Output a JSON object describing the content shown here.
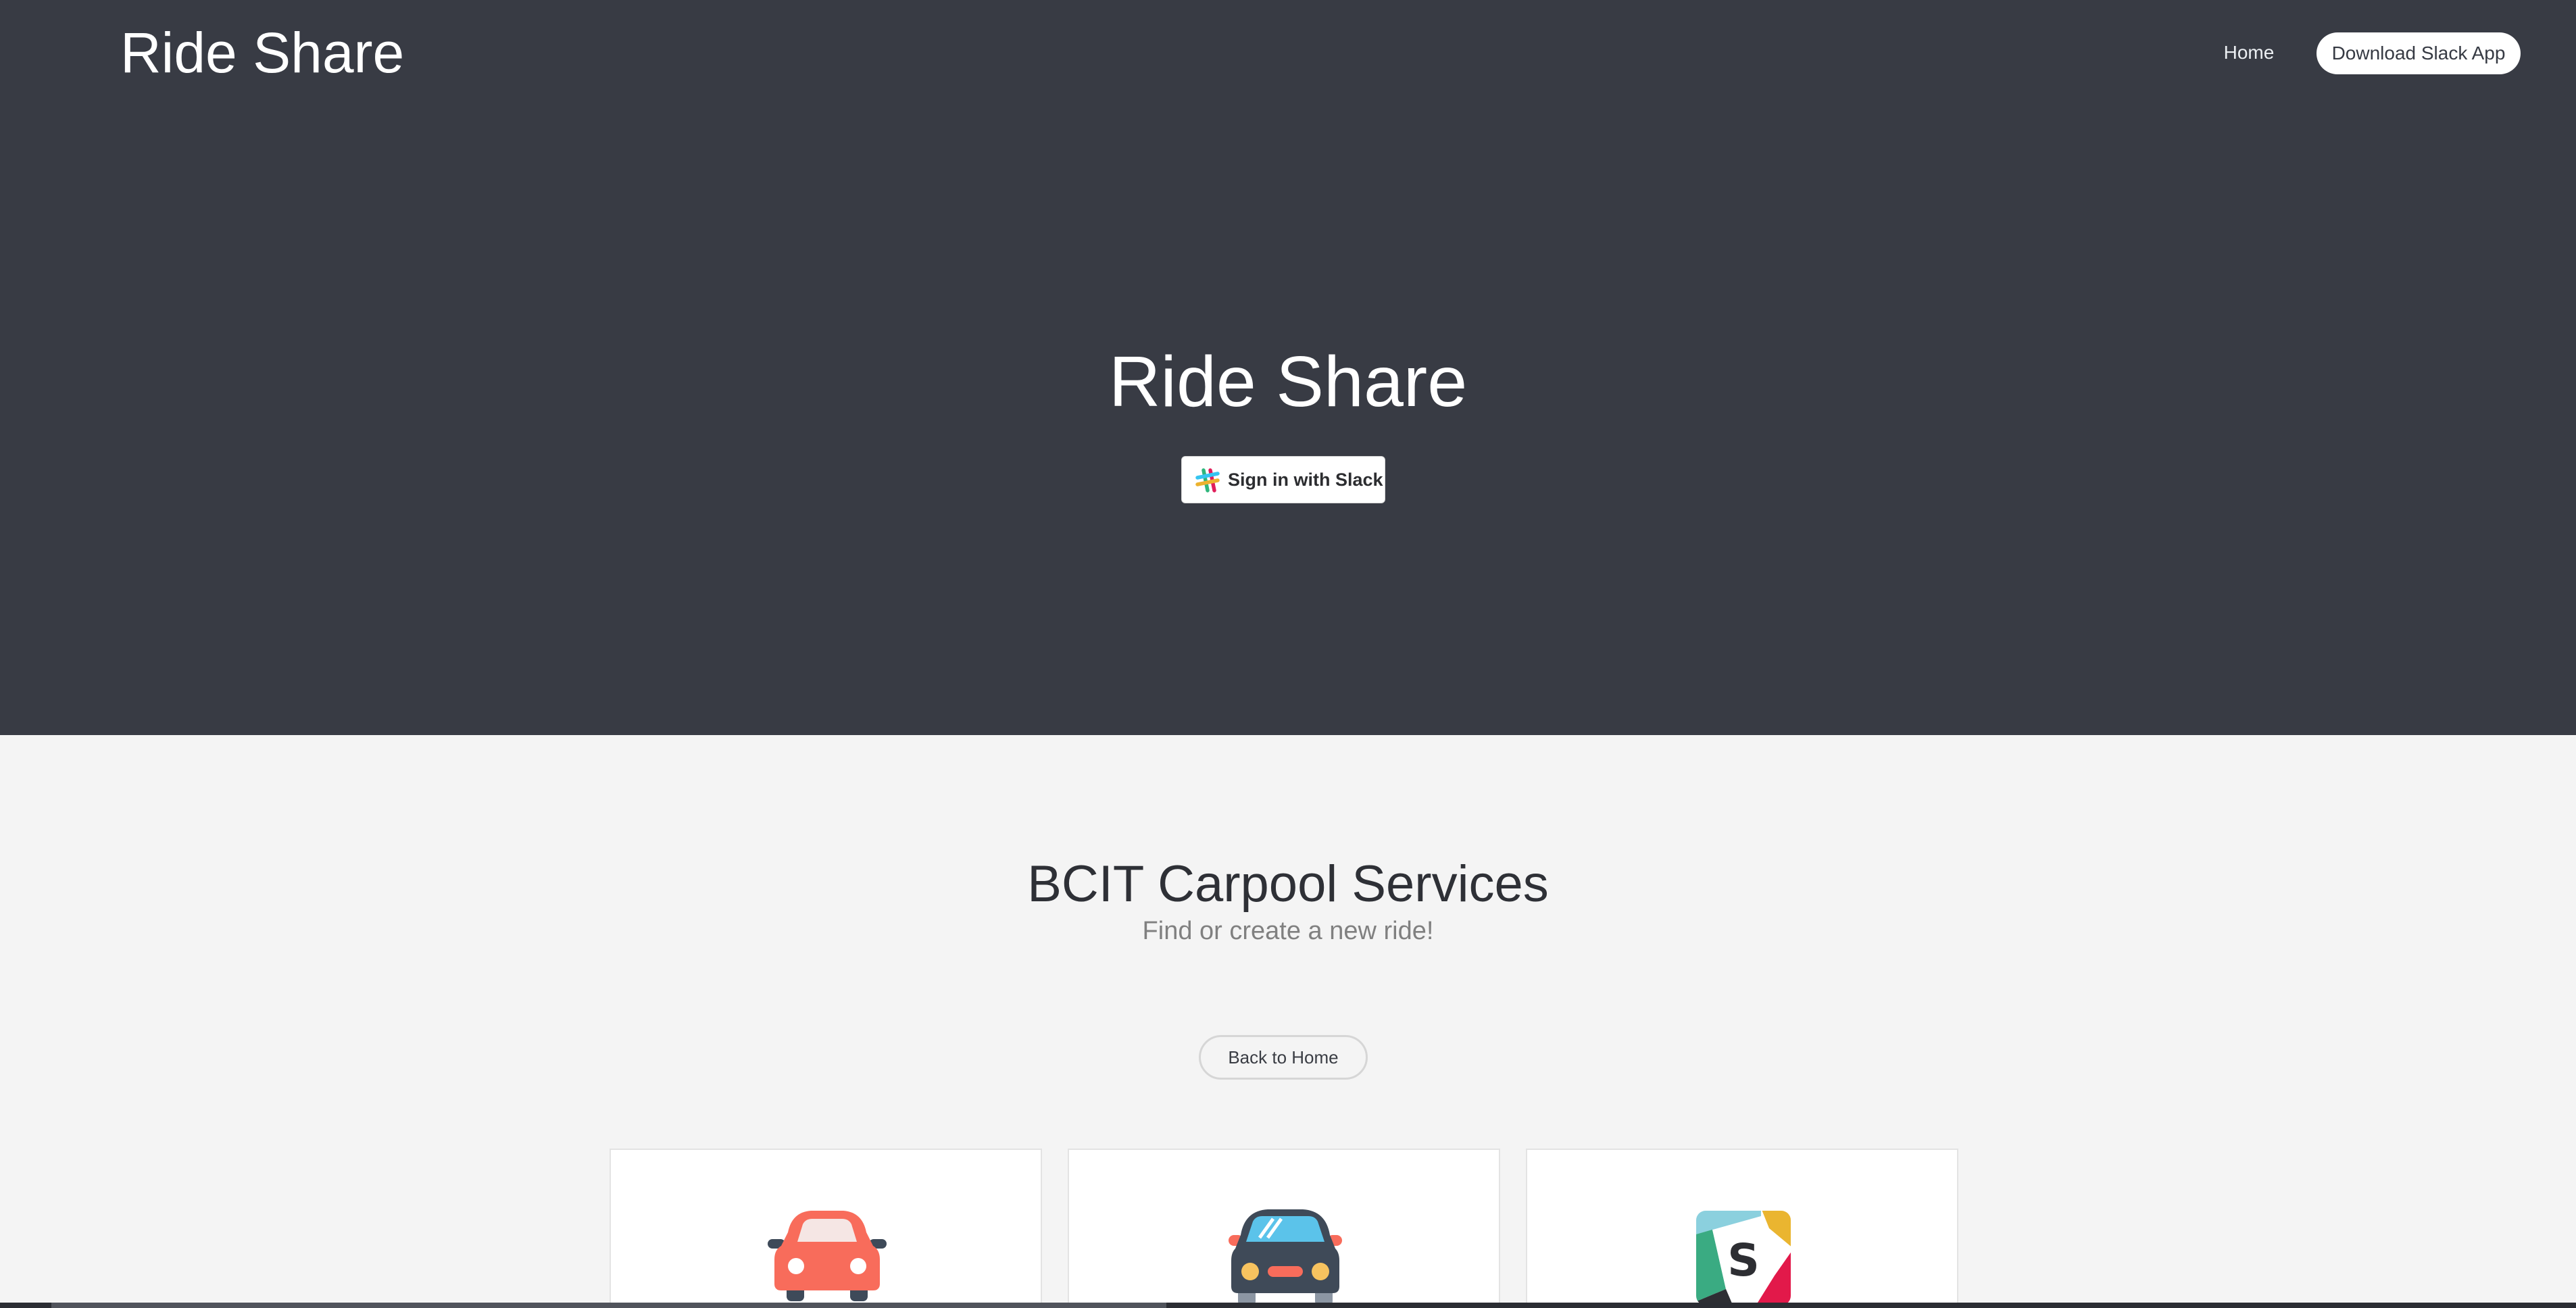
{
  "header": {
    "brand": "Ride Share",
    "nav_home": "Home",
    "nav_download": "Download Slack App"
  },
  "hero": {
    "title": "Ride Share",
    "signin_label": "Sign in with Slack"
  },
  "main": {
    "title": "BCIT Carpool Services",
    "subtitle": "Find or create a new ride!",
    "back_button": "Back to Home"
  },
  "cards": [
    {
      "icon": "red-car-icon"
    },
    {
      "icon": "dark-car-front-icon"
    },
    {
      "icon": "slack-app-icon"
    }
  ],
  "colors": {
    "hero_background": "#383b44",
    "page_background": "#f4f4f4",
    "car_red": "#f86c5b",
    "car_dark": "#3f4a58",
    "car_window_blue": "#5bc3ea"
  }
}
